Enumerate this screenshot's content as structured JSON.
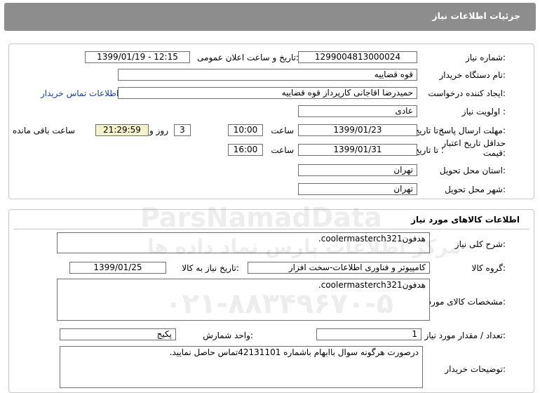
{
  "header": {
    "title": "جزئیات اطلاعات نیاز"
  },
  "need_info": {
    "need_number_label": "شماره نیاز:",
    "need_number": "1299004813000024",
    "announce_label": "تاریخ و ساعت اعلان عمومی:",
    "announce_value": "1399/01/19 - 12:15",
    "buyer_label": "نام دستگاه خریدار:",
    "buyer_value": "قوه قضاییه",
    "creator_label": "ایجاد کننده درخواست:",
    "creator_value": "حمیدرضا اقاجانی کارپرداز قوه قضاییه",
    "contact_link": "اطلاعات تماس خریدار",
    "priority_label": "اولویت نیاز :",
    "priority_value": "عادی",
    "deadline_label": "مهلت ارسال پاسخ:",
    "to_date_label": "تا تاریخ :",
    "deadline_date": "1399/01/23",
    "time_label": "ساعت",
    "deadline_time": "10:00",
    "days_value": "3",
    "days_label": "روز و",
    "remaining_time": "21:29:59",
    "remaining_label": "ساعت باقی مانده",
    "validity_label_1": "حداقل تاریخ اعتبار",
    "validity_label_2": "قیمت:",
    "validity_date": "1399/01/31",
    "validity_time": "16:00",
    "province_label": "استان محل تحویل:",
    "province_value": "تهران",
    "city_label": "شهر محل تحویل:",
    "city_value": "تهران"
  },
  "goods": {
    "title": "اطلاعات کالاهای مورد نیاز",
    "summary_label": "شرح کلی نیاز:",
    "summary_value": "هدفونcoolermasterch321.",
    "group_label": "گروه کالا:",
    "group_value": "کامپیوتر و فناوری اطلاعات-سخت افزار",
    "need_date_label": "تاریخ نیاز به کالا:",
    "need_date_value": "1399/01/25",
    "specs_label": "مشخصات کالای مورد نیاز:",
    "specs_value": "هدفونcoolermasterch321.",
    "qty_label": "تعداد / مقدار مورد نیاز:",
    "qty_value": "1",
    "unit_label": "واحد شمارش:",
    "unit_value": "پکیج",
    "buyer_notes_label": "توضیحات خریدار:",
    "buyer_notes_value": "درصورت هرگونه سوال باابهام باشماره 42131101تماس حاصل نمایید."
  },
  "watermark": {
    "brand": "ParsNamadData",
    "persian": "مرکز اطلاعات پارس نماد داده ها",
    "phone": "۰۲۱-۸۸۳۴۹۶۷۰-۵"
  },
  "colors": {
    "header_bg": "#8d8d8d",
    "link": "#1b3f9c",
    "remaining_bg": "#f5f1c8"
  }
}
